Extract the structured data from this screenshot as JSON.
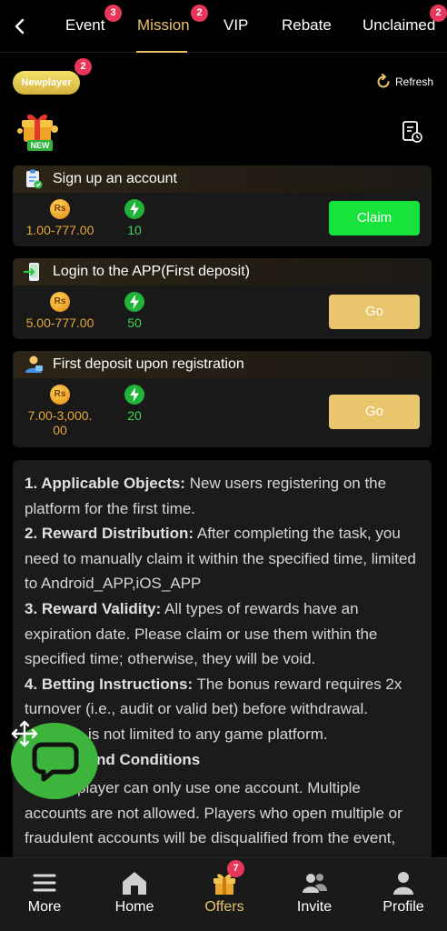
{
  "tabs": [
    {
      "label": "Event",
      "badge": "3"
    },
    {
      "label": "Mission",
      "badge": "2",
      "active": true
    },
    {
      "label": "VIP"
    },
    {
      "label": "Rebate"
    },
    {
      "label": "Unclaimed",
      "badge": "2"
    }
  ],
  "header": {
    "newplayer_label": "Newplayer",
    "newplayer_badge": "2",
    "refresh_label": "Refresh",
    "gift_badge": "NEW"
  },
  "tasks": [
    {
      "title": "Sign up an account",
      "amount": "1.00-777.00",
      "points": "10",
      "button": "Claim",
      "currency": "Rs"
    },
    {
      "title": "Login to the APP(First deposit)",
      "amount": "5.00-777.00",
      "points": "50",
      "button": "Go",
      "currency": "Rs"
    },
    {
      "title": "First deposit upon registration",
      "amount_line1": "7.00-3,000.",
      "amount_line2": "00",
      "points": "20",
      "button": "Go",
      "currency": "Rs"
    }
  ],
  "rules": {
    "r1_head": "1. Applicable Objects:",
    "r1_body": " New users registering on the platform for the first time.",
    "r2_head": "2. Reward Distribution:",
    "r2_body": " After completing the task, you need to manually claim it within the specified time, limited to Android_APP,iOS_APP",
    "r3_head": "3. Reward Validity:",
    "r3_body": " All types of rewards have an expiration date. Please claim or use them within the specified time; otherwise, they will be void.",
    "r4_head": "4. Betting Instructions:",
    "r4_body": " The bonus reward requires 2x turnover (i.e., audit or valid bet) before withdrawal. ",
    "r4_tail": "is not limited to any game platform.",
    "r5_head": "nd Conditions",
    "r5_body_lead": "player can only use one account. Multiple accounts are not allowed. Players who open multiple or fraudulent accounts will be disqualified from the event,"
  },
  "bottom_nav": [
    {
      "label": "More",
      "icon": "menu-icon"
    },
    {
      "label": "Home",
      "icon": "home-icon"
    },
    {
      "label": "Offers",
      "icon": "gift-icon",
      "badge": "7",
      "active": true
    },
    {
      "label": "Invite",
      "icon": "people-icon"
    },
    {
      "label": "Profile",
      "icon": "person-icon"
    }
  ],
  "colors": {
    "accent_gold": "#e8c36a",
    "claim_green": "#18e23c",
    "go_gold": "#e9c56c",
    "badge_red": "#e8375a",
    "chat_green": "#3db43b"
  }
}
